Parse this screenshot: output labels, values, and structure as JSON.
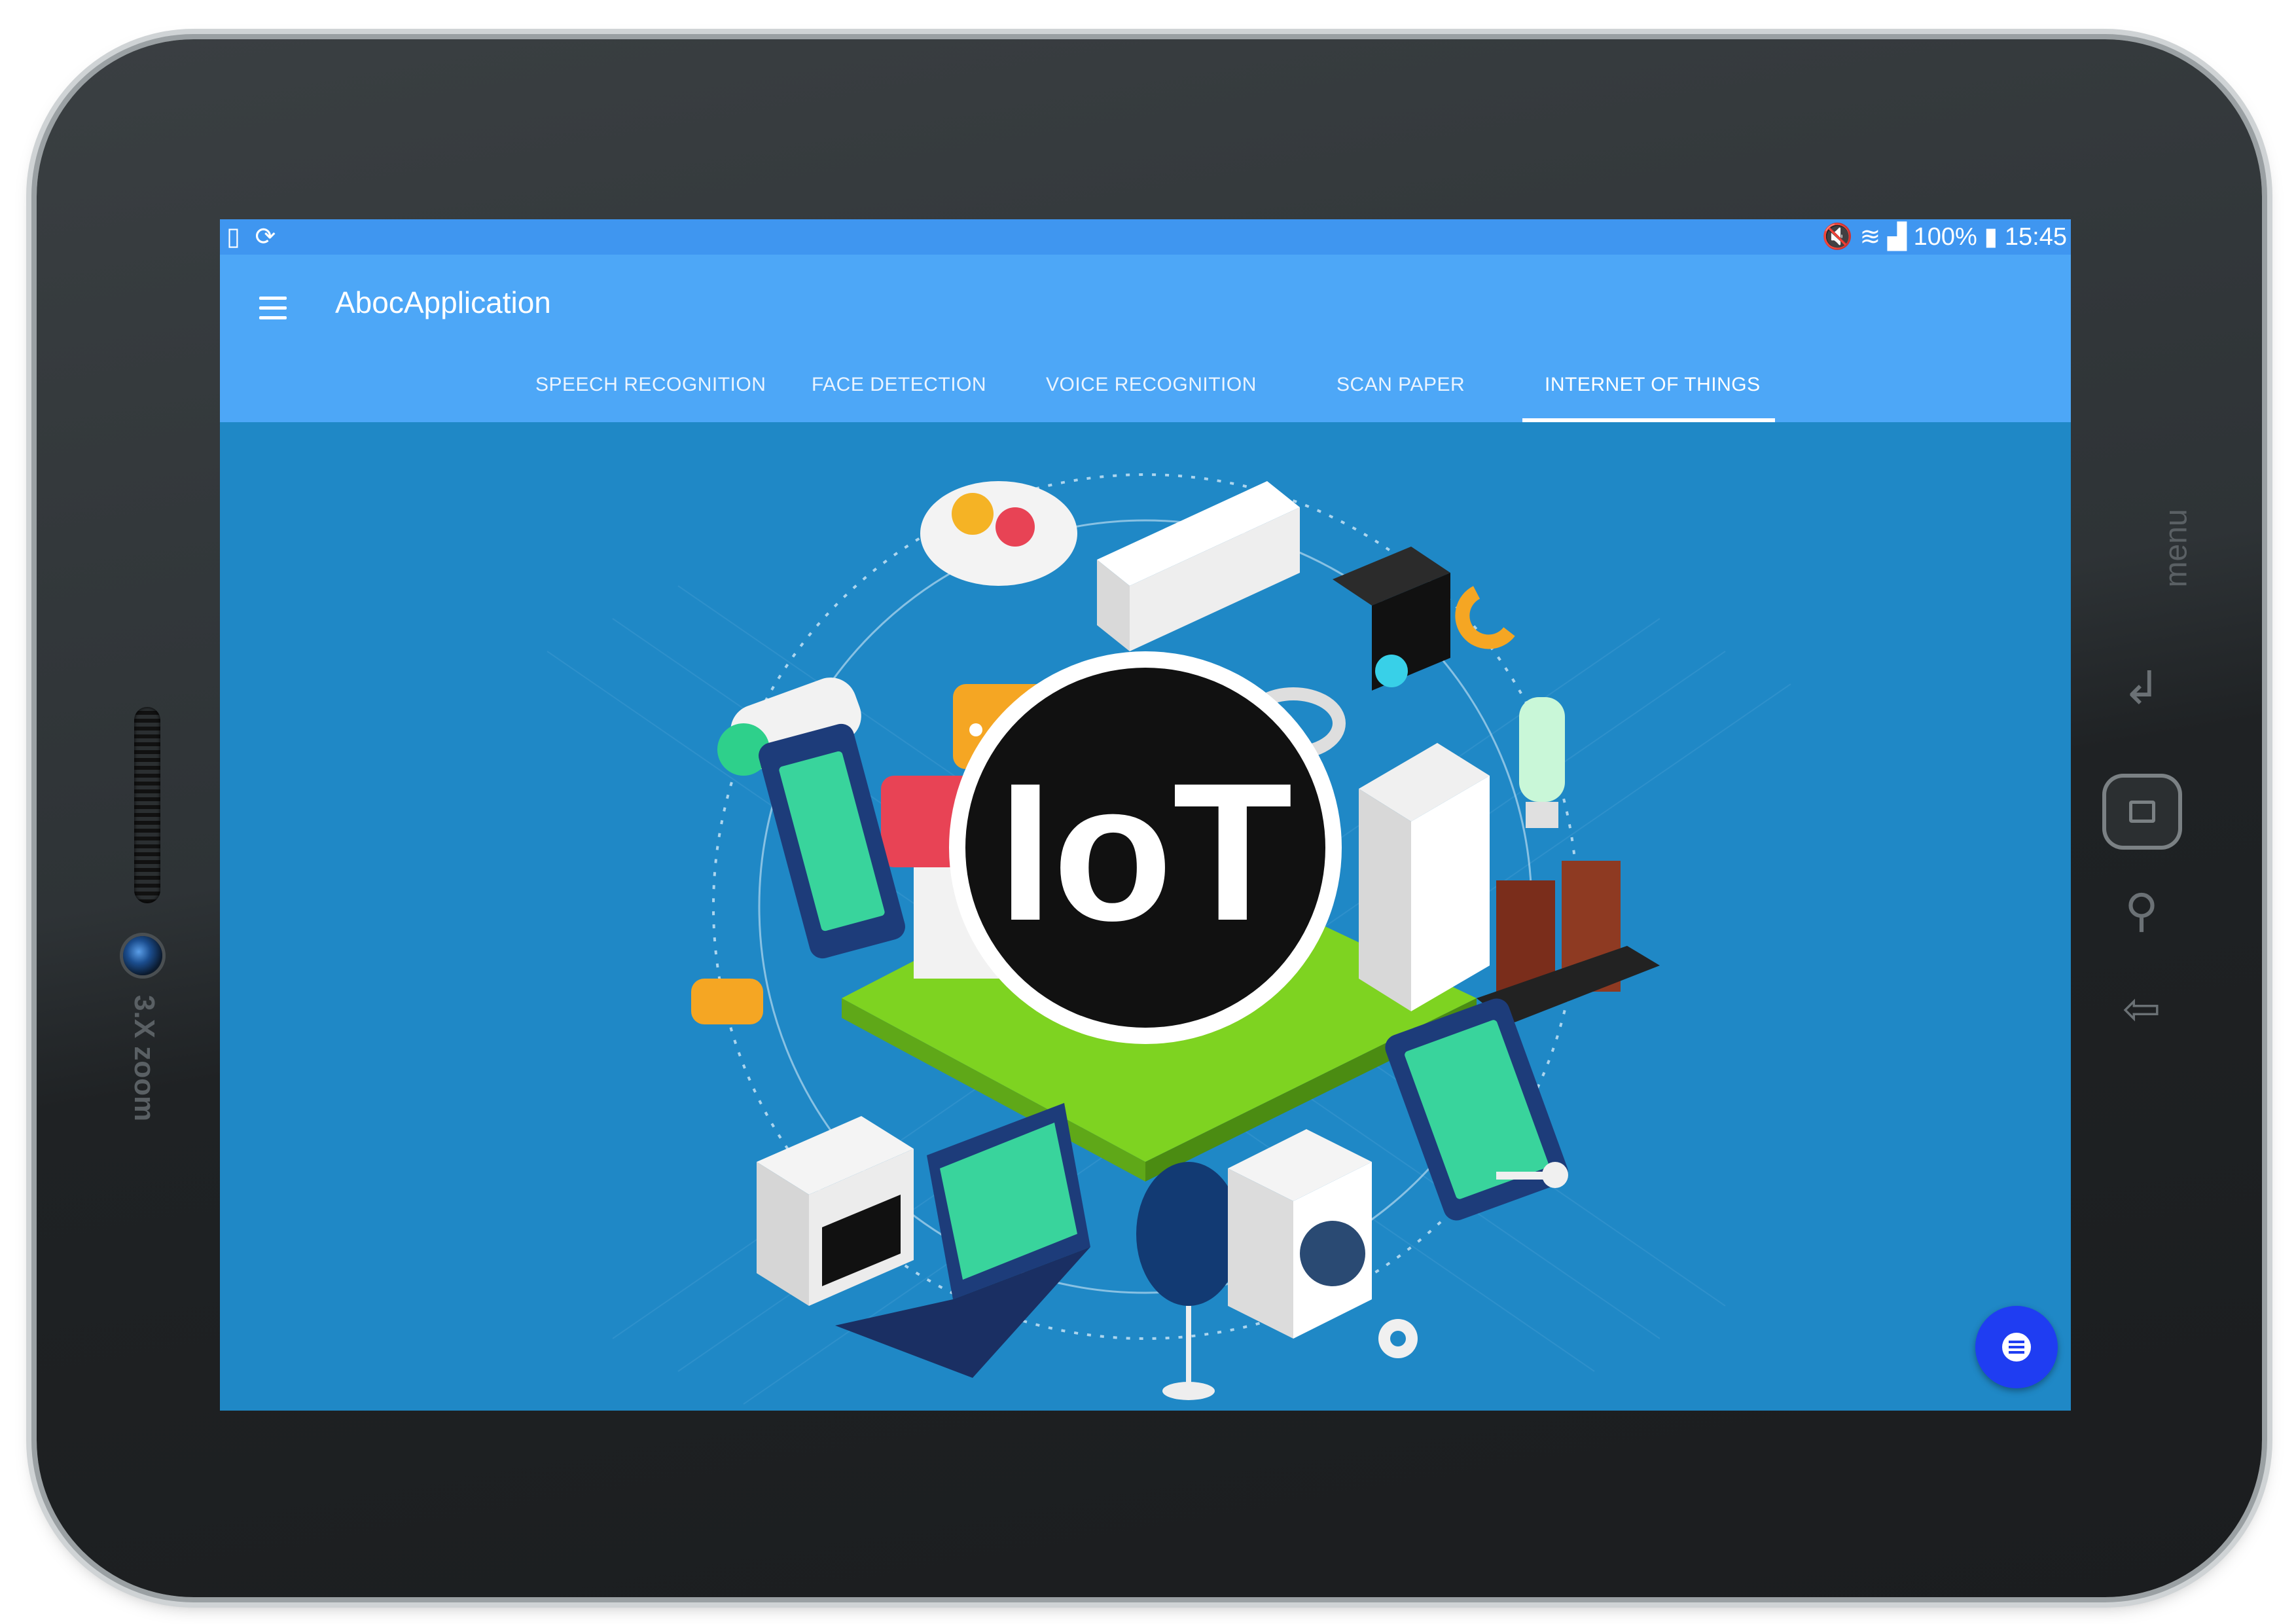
{
  "device": {
    "camera_label": "3.X zoom",
    "side_label": "menu"
  },
  "status_bar": {
    "left_icons": [
      "screenshot-icon",
      "sync-icon"
    ],
    "right_icons": [
      "mute-icon",
      "wifi-icon",
      "signal-icon",
      "battery-icon"
    ],
    "battery": "100%",
    "time": "15:45",
    "background": "#3f96f0"
  },
  "app_bar": {
    "title": "AbocApplication",
    "menu_icon": "hamburger-menu-icon",
    "background": "#4da7f7"
  },
  "tabs": [
    {
      "label": "SPEECH RECOGNITION"
    },
    {
      "label": "FACE DETECTION"
    },
    {
      "label": "VOICE RECOGNITION"
    },
    {
      "label": "SCAN PAPER"
    },
    {
      "label": "INTERNET OF THINGS",
      "selected": true
    }
  ],
  "main": {
    "background": "#1f88c6",
    "badge_text": "IoT"
  },
  "fab": {
    "icon": "list-icon",
    "color": "#1f3df2"
  }
}
